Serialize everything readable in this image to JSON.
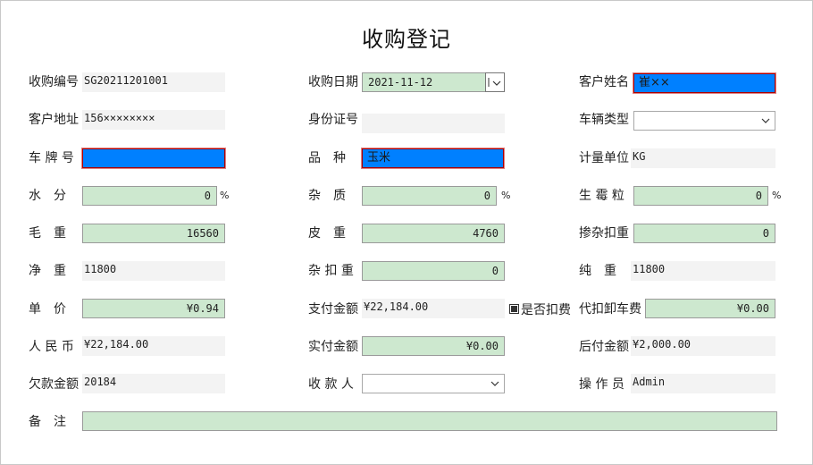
{
  "title": "收购登记",
  "fields": {
    "purchase_no": {
      "label": "收购编号",
      "value": "SG20211201001"
    },
    "purchase_date": {
      "label": "收购日期",
      "value": "2021-11-12"
    },
    "customer_name": {
      "label": "客户姓名",
      "value": "崔××"
    },
    "customer_address": {
      "label": "客户地址",
      "value": "156××××××××"
    },
    "id_number": {
      "label": "身份证号",
      "value": ""
    },
    "vehicle_type": {
      "label": "车辆类型",
      "value": ""
    },
    "plate_no": {
      "label": "车 牌 号",
      "value": ""
    },
    "variety": {
      "label": "品　种",
      "value": "玉米"
    },
    "unit": {
      "label": "计量单位",
      "value": "KG"
    },
    "moisture": {
      "label": "水　分",
      "value": "0",
      "unit": "%"
    },
    "impurity": {
      "label": "杂　质",
      "value": "0",
      "unit": "%"
    },
    "mold": {
      "label": "生 霉 粒",
      "value": "0",
      "unit": "%"
    },
    "gross_weight": {
      "label": "毛　重",
      "value": "16560"
    },
    "tare_weight": {
      "label": "皮　重",
      "value": "4760"
    },
    "mixed_deduction": {
      "label": "掺杂扣重",
      "value": "0"
    },
    "net_weight": {
      "label": "净　重",
      "value": "11800"
    },
    "impurity_deduction": {
      "label": "杂 扣 重",
      "value": "0"
    },
    "pure_weight": {
      "label": "纯　重",
      "value": "11800"
    },
    "unit_price": {
      "label": "单　价",
      "value": "¥0.94"
    },
    "payable_amount": {
      "label": "支付金额",
      "value": "¥22,184.00"
    },
    "deduct_fee": {
      "label": "是否扣费",
      "checked": true
    },
    "unloading_fee": {
      "label": "代扣卸车费",
      "value": "¥0.00"
    },
    "rmb": {
      "label": "人 民 币",
      "value": "¥22,184.00"
    },
    "actual_paid": {
      "label": "实付金额",
      "value": "¥0.00"
    },
    "post_paid": {
      "label": "后付金额",
      "value": "¥2,000.00"
    },
    "arrears": {
      "label": "欠款金额",
      "value": "20184"
    },
    "payee": {
      "label": "收 款 人",
      "value": ""
    },
    "operator": {
      "label": "操 作 员",
      "value": "Admin"
    },
    "remark": {
      "label": "备　注",
      "value": ""
    }
  },
  "colors": {
    "editable_bg": "#cde8cf",
    "selected_bg": "#0080ff",
    "readonly_bg": "#f3f3f3",
    "error_border": "#b00000"
  }
}
